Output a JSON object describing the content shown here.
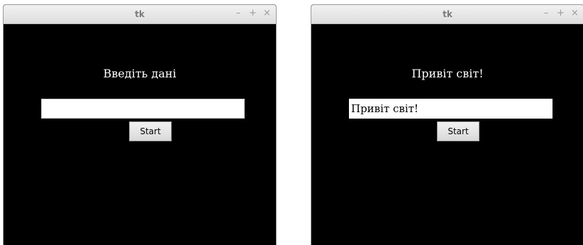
{
  "windows": [
    {
      "title": "tk",
      "controls": {
        "minimize": "–",
        "maximize": "+",
        "close": "×"
      },
      "label": "Введіть дані",
      "entry": {
        "value": "",
        "placeholder": ""
      },
      "button": {
        "label": "Start"
      }
    },
    {
      "title": "tk",
      "controls": {
        "minimize": "–",
        "maximize": "+",
        "close": "×"
      },
      "label": "Привіт світ!",
      "entry": {
        "value": "Привіт світ!",
        "placeholder": ""
      },
      "button": {
        "label": "Start"
      }
    }
  ],
  "colors": {
    "window_bg": "#000000",
    "titlebar_text": "#7a7a7a",
    "label_text": "#ffffff",
    "entry_bg": "#ffffff",
    "button_bg": "#e6e6e6"
  },
  "icons": {
    "minimize": "minimize-icon",
    "maximize": "maximize-icon",
    "close": "close-icon"
  }
}
